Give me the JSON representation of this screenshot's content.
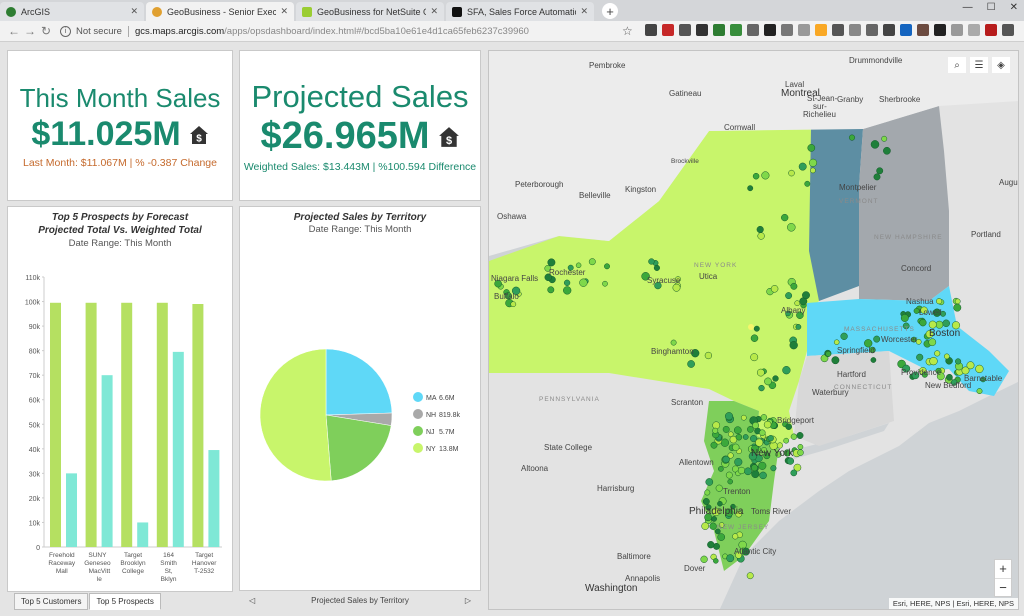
{
  "browser": {
    "tabs": [
      {
        "title": "ArcGIS",
        "color": "#2e7d32"
      },
      {
        "title": "GeoBusiness - Senior Executive D",
        "color": "#e0a030"
      },
      {
        "title": "GeoBusiness for NetSuite GCS",
        "color": "#9acd32"
      },
      {
        "title": "SFA, Sales Force Automation, Sal",
        "color": "#111111"
      }
    ],
    "url_security": "Not secure",
    "url_host": "gcs.maps.arcgis.com",
    "url_path": "/apps/opsdashboard/index.html#/bcd5ba10e61e4d1ca65feb6237c39960"
  },
  "kpis": {
    "month": {
      "title": "This Month Sales",
      "value": "$11.025M",
      "sub": "Last Month: $11.067M | % -0.387 Change"
    },
    "projected": {
      "title": "Projected Sales",
      "value": "$26.965M",
      "sub": "Weighted Sales: $13.443M | %100.594 Difference"
    }
  },
  "bar_panel": {
    "title_line1": "Top 5 Prospects by Forecast",
    "title_line2": "Projected Total Vs. Weighted Total",
    "date_range": "Date Range: This Month",
    "tabs": [
      "Top 5 Customers",
      "Top 5 Prospects"
    ]
  },
  "pie_panel": {
    "title": "Projected Sales by Territory",
    "date_range": "Date Range: This Month",
    "footer": "Projected Sales by Territory"
  },
  "map": {
    "attribution": "Esri, HERE, NPS | Esri, HERE, NPS",
    "labels": {
      "pembroke": "Pembroke",
      "laval": "Laval",
      "montreal": "Montreal",
      "drummondville": "Drummondville",
      "gatineau": "Gatineau",
      "granby": "Granby",
      "sherbrooke": "Sherbrooke",
      "stjean": "St-Jean-",
      "richelieu": "sur-",
      "richelieu2": "Richelieu",
      "cornwall": "Cornwall",
      "brockville": "Brockville",
      "kingston": "Kingston",
      "belleville": "Belleville",
      "peterborough": "Peterborough",
      "oshawa": "Oshawa",
      "montpelier": "Montpelier",
      "vermont": "VERMONT",
      "nh": "NEW HAMPSHIRE",
      "augusta": "Augu",
      "portland": "Portland",
      "concord": "Concord",
      "nashua": "Nashua",
      "lowell": "Lowell",
      "boston": "Boston",
      "worcester": "Worcester",
      "springfield": "Springfield",
      "hartford": "Hartford",
      "providence": "Providence",
      "newbedford": "New Bedford",
      "barnstable": "Barnstable",
      "waterbury": "Waterbury",
      "bridgeport": "Bridgeport",
      "newyork": "New York",
      "newyorkstate": "NEW YORK",
      "rochester": "Rochester",
      "buffalo": "Buffalo",
      "niagara": "Niagara Falls",
      "syracuse": "Syracuse",
      "utica": "Utica",
      "albany": "Albany",
      "binghamton": "Binghamton",
      "scranton": "Scranton",
      "pennsylvania": "PENNSYLVANIA",
      "statecollege": "State College",
      "allentown": "Allentown",
      "altoona": "Altoona",
      "harrisburg": "Harrisburg",
      "trenton": "Trenton",
      "tomsriver": "Toms River",
      "philadelphia": "Philadelphia",
      "atlanticcity": "Atlantic City",
      "baltimore": "Baltimore",
      "annapolis": "Annapolis",
      "dover": "Dover",
      "washington": "Washington",
      "newjersey": "NEW JERSEY",
      "connecticut": "CONNECTICUT",
      "massachusetts": "MASSACHUSETTS"
    }
  },
  "colors": {
    "accent": "#1a8a6e",
    "orange": "#c56a2d",
    "bar_green": "#b5e061",
    "bar_teal": "#7fe8d6"
  },
  "chart_data": [
    {
      "type": "bar",
      "categories": [
        "Freehold Raceway Mall",
        "SUNY Geneseo MacVitt le",
        "Target Brooklyn College",
        "164 Smith St, Bklyn",
        "Target Hanover T-2532"
      ],
      "series": [
        {
          "values": [
            99500,
            99500,
            99500,
            99500,
            99000
          ]
        },
        {
          "values": [
            30000,
            70000,
            10000,
            79500,
            39500
          ]
        }
      ],
      "yticks": [
        "0",
        "10k",
        "20k",
        "30k",
        "40k",
        "50k",
        "60k",
        "70k",
        "80k",
        "90k",
        "100k",
        "110k"
      ],
      "ylim": [
        0,
        110000
      ]
    },
    {
      "type": "pie",
      "slices": [
        {
          "name": "MA",
          "label": "6.6M",
          "value": 6.6,
          "color": "#5fd8f7"
        },
        {
          "name": "NH",
          "label": "819.8k",
          "value": 0.8198,
          "color": "#a9a9a9"
        },
        {
          "name": "NJ",
          "label": "5.7M",
          "value": 5.7,
          "color": "#7fcf5b"
        },
        {
          "name": "NY",
          "label": "13.8M",
          "value": 13.8,
          "color": "#c8f56b"
        }
      ]
    }
  ]
}
